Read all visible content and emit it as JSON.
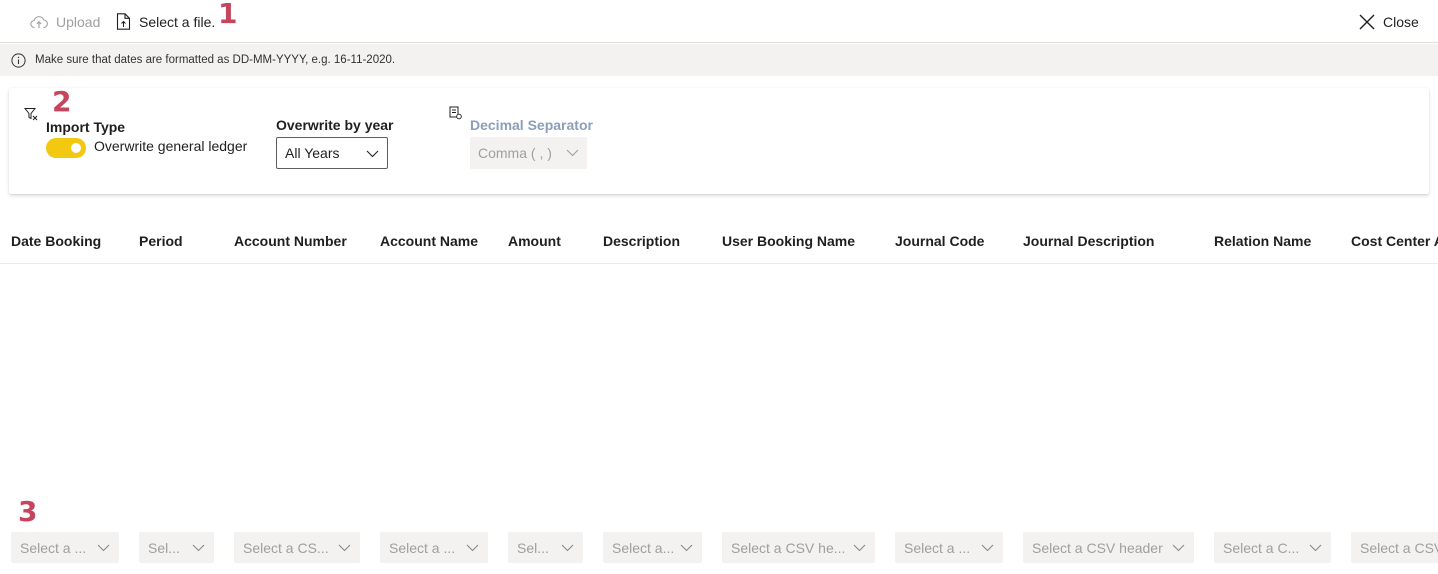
{
  "toolbar": {
    "upload_label": "Upload",
    "select_file_label": "Select a file.",
    "close_label": "Close"
  },
  "markers": [
    "1",
    "2",
    "3"
  ],
  "info": {
    "message": "Make sure that dates are formatted as DD-MM-YYYY, e.g. 16-11-2020."
  },
  "options": {
    "import_type_label": "Import Type",
    "toggle_text": "Overwrite general ledger",
    "toggle_on": true,
    "overwrite_by_year_label": "Overwrite by year",
    "overwrite_by_year_value": "All Years",
    "decimal_separator_label": "Decimal Separator",
    "decimal_separator_value": "Comma ( , )"
  },
  "table": {
    "columns": [
      "Date Booking",
      "Period",
      "Account Number",
      "Account Name",
      "Amount",
      "Description",
      "User Booking Name",
      "Journal Code",
      "Journal Description",
      "Relation Name",
      "Cost Center A"
    ]
  },
  "csv_selects": [
    "Select a ...",
    "Sel...",
    "Select a CS...",
    "Select a ...",
    "Sel...",
    "Select a...",
    "Select a CSV he...",
    "Select a ...",
    "Select a CSV header",
    "Select a C...",
    "Select a CSV"
  ],
  "colors": {
    "accent_toggle": "#f2c811",
    "marker": "#c4455d",
    "info_bg": "#f3f2f1"
  }
}
